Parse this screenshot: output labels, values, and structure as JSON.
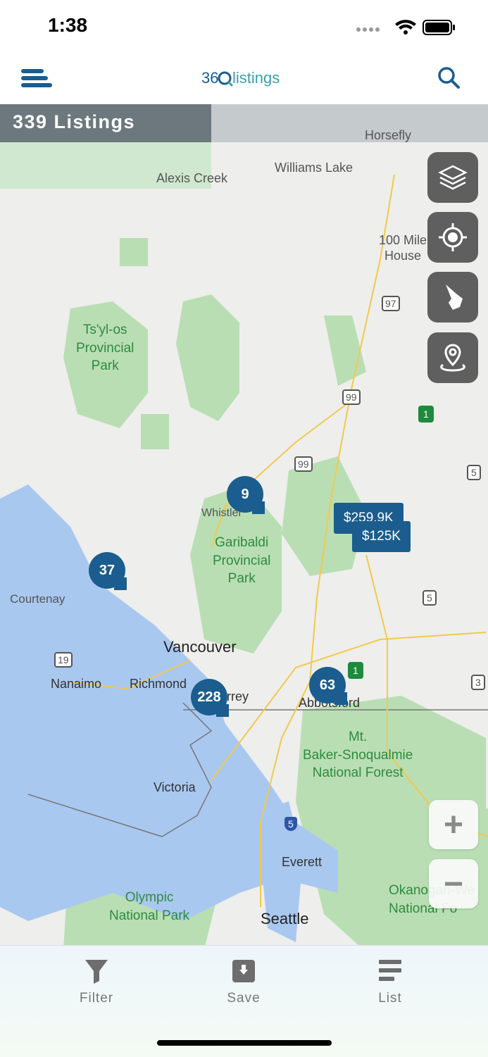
{
  "status_bar": {
    "time": "1:38"
  },
  "header": {
    "logo_text": "360listings"
  },
  "listings": {
    "count_label": "339 Listings"
  },
  "map": {
    "places": {
      "horsefly": "Horsefly",
      "alexis_creek": "Alexis Creek",
      "williams_lake": "Williams Lake",
      "hundred_mile": "100 Mile\nHouse",
      "tsylos": "Ts'yl-os\nProvincial\nPark",
      "whistler": "Whistler",
      "garibaldi": "Garibaldi\nProvincial\nPark",
      "courtenay": "Courtenay",
      "vancouver": "Vancouver",
      "nanaimo": "Nanaimo",
      "richmond": "Richmond",
      "surrey": "rrey",
      "abbotsford": "Abbotsford",
      "mt_baker": "Mt.\nBaker-Snoqualmie\nNational Forest",
      "victoria": "Victoria",
      "everett": "Everett",
      "olympic": "Olympic\nNational Park",
      "seattle": "Seattle",
      "okanogan": "Okanogan-We\nNational Fo"
    },
    "highways": {
      "h97": "97",
      "h99a": "99",
      "h99b": "99",
      "h5a": "5",
      "h5b": "5",
      "h19": "19",
      "h3": "3",
      "i5": "5",
      "can1a": "1",
      "can1b": "1"
    },
    "clusters": {
      "c9": "9",
      "c37": "37",
      "c228": "228",
      "c63": "63"
    },
    "price_tags": {
      "p1": "$259.9K",
      "p2": "$125K"
    },
    "buttons": {
      "zoom_in": "+",
      "zoom_out": "−"
    }
  },
  "bottom_nav": {
    "filter": "Filter",
    "save": "Save",
    "list": "List"
  },
  "icons": [
    "menu-icon",
    "search-icon",
    "layers-icon",
    "locate-icon",
    "draw-icon",
    "pin-icon",
    "filter-icon",
    "save-icon",
    "list-icon"
  ]
}
